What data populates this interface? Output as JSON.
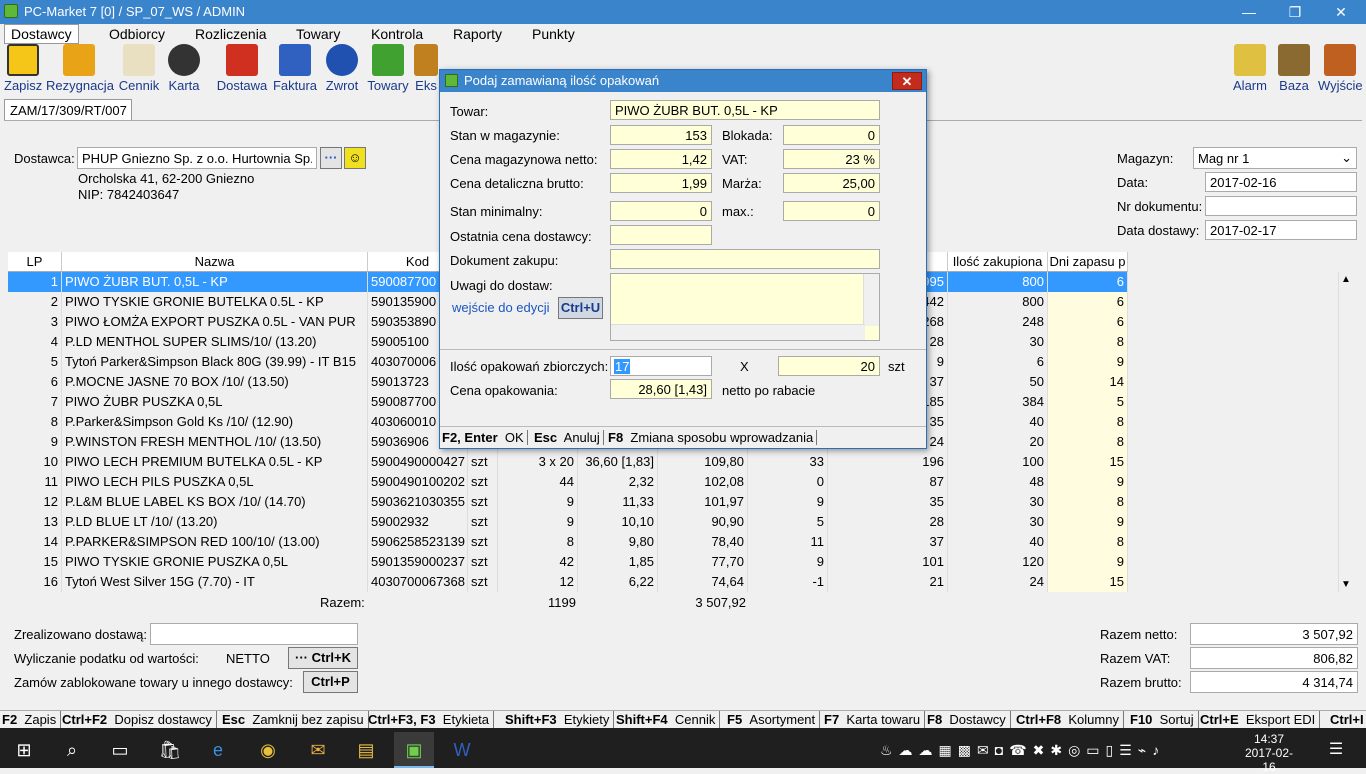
{
  "window": {
    "title": "PC-Market 7 [0] / SP_07_WS / ADMIN",
    "min": "—",
    "max": "❐",
    "close": "✕"
  },
  "menu": [
    "Dostawcy",
    "Odbiorcy",
    "Rozliczenia",
    "Towary",
    "Kontrola",
    "Raporty",
    "Punkty"
  ],
  "toolbar": {
    "left": [
      "Zapisz",
      "Rezygnacja",
      "Cennik",
      "Karta",
      "Dostawa",
      "Faktura",
      "Zwrot",
      "Towary",
      "Eks"
    ],
    "right": [
      "Alarm",
      "Baza",
      "Wyjście"
    ]
  },
  "doc_tab": "ZAM/17/309/RT/007",
  "supplier": {
    "label": "Dostawca:",
    "name": "PHUP Gniezno Sp. z o.o. Hurtownia Sp.",
    "address": "Orcholska 41, 62-200 Gniezno",
    "nip": "NIP: 7842403647",
    "dots": "···"
  },
  "right_fields": {
    "magazyn_label": "Magazyn:",
    "magazyn": "Mag nr 1",
    "data_label": "Data:",
    "data": "2017-02-16",
    "nrdok_label": "Nr dokumentu:",
    "nrdok": "",
    "datadost_label": "Data dostawy:",
    "datadost": "2017-02-17"
  },
  "grid": {
    "headers": [
      "LP",
      "Nazwa",
      "Kod",
      "",
      "",
      "",
      "",
      "",
      "",
      "a",
      "Ilość zakupiona",
      "Dni zapasu p"
    ],
    "rows": [
      [
        "1",
        "PIWO ŻUBR BUT. 0,5L - KP",
        "590087700",
        "",
        "",
        "",
        "",
        "",
        "",
        "995",
        "800",
        "6"
      ],
      [
        "2",
        "PIWO TYSKIE GRONIE BUTELKA 0.5L - KP",
        "590135900",
        "",
        "",
        "",
        "",
        "",
        "",
        "442",
        "800",
        "6"
      ],
      [
        "3",
        "PIWO ŁOMŻA EXPORT PUSZKA 0.5L - VAN PUR",
        "590353890",
        "",
        "",
        "",
        "",
        "",
        "",
        "268",
        "248",
        "6"
      ],
      [
        "4",
        "P.LD MENTHOL SUPER SLIMS/10/ (13.20)",
        "59005100",
        "",
        "",
        "",
        "",
        "",
        "",
        "28",
        "30",
        "8"
      ],
      [
        "5",
        "Tytoń Parker&Simpson Black 80G (39.99) - IT B15",
        "403070006",
        "",
        "",
        "",
        "",
        "",
        "",
        "9",
        "6",
        "9"
      ],
      [
        "6",
        "P.MOCNE JASNE 70 BOX /10/ (13.50)",
        "59013723",
        "",
        "",
        "",
        "",
        "",
        "",
        "37",
        "50",
        "14"
      ],
      [
        "7",
        "PIWO ŻUBR PUSZKA 0,5L",
        "590087700",
        "",
        "",
        "",
        "",
        "",
        "",
        "185",
        "384",
        "5"
      ],
      [
        "8",
        "P.Parker&Simpson Gold Ks /10/ (12.90)",
        "403060010",
        "",
        "",
        "",
        "",
        "",
        "",
        "35",
        "40",
        "8"
      ],
      [
        "9",
        "P.WINSTON FRESH MENTHOL /10/ (13.50)",
        "59036906",
        "",
        "",
        "",
        "",
        "",
        "",
        "24",
        "20",
        "8"
      ],
      [
        "10",
        "PIWO LECH PREMIUM BUTELKA 0.5L - KP",
        "5900490000427",
        "szt",
        "3 x 20",
        "36,60 [1,83]",
        "109,80",
        "33",
        "",
        "196",
        "100",
        "15"
      ],
      [
        "11",
        "PIWO LECH PILS PUSZKA 0,5L",
        "5900490100202",
        "szt",
        "44",
        "2,32",
        "102,08",
        "0",
        "",
        "87",
        "48",
        "9"
      ],
      [
        "12",
        "P.L&M BLUE LABEL KS BOX /10/ (14.70)",
        "5903621030355",
        "szt",
        "9",
        "11,33",
        "101,97",
        "9",
        "",
        "35",
        "30",
        "8"
      ],
      [
        "13",
        "P.LD BLUE LT /10/ (13.20)",
        "59002932",
        "szt",
        "9",
        "10,10",
        "90,90",
        "5",
        "",
        "28",
        "30",
        "9"
      ],
      [
        "14",
        "P.PARKER&SIMPSON RED 100/10/ (13.00)",
        "5906258523139",
        "szt",
        "8",
        "9,80",
        "78,40",
        "11",
        "",
        "37",
        "40",
        "8"
      ],
      [
        "15",
        "PIWO TYSKIE GRONIE PUSZKA 0,5L",
        "5901359000237",
        "szt",
        "42",
        "1,85",
        "77,70",
        "9",
        "",
        "101",
        "120",
        "9"
      ],
      [
        "16",
        "Tytoń West Silver 15G (7.70) - IT",
        "4030700067368",
        "szt",
        "12",
        "6,22",
        "74,64",
        "-1",
        "",
        "21",
        "24",
        "15"
      ]
    ],
    "razem_label": "Razem:",
    "razem_qty": "1199",
    "razem_value": "3 507,92"
  },
  "bottom": {
    "zrealizowano_label": "Zrealizowano dostawą:",
    "zrealizowano": "",
    "podatek_label": "Wyliczanie podatku od wartości:",
    "podatek": "NETTO",
    "ctrlk": "··· Ctrl+K",
    "zablok_label": "Zamów zablokowane towary u innego dostawcy:",
    "ctrlp": "Ctrl+P",
    "netto_label": "Razem netto:",
    "netto": "3 507,92",
    "vat_label": "Razem VAT:",
    "vat": "806,82",
    "brutto_label": "Razem brutto:",
    "brutto": "4 314,74"
  },
  "status_keys": [
    {
      "k": "F2",
      "t": "Zapis"
    },
    {
      "k": "Ctrl+F2",
      "t": "Dopisz dostawcy"
    },
    {
      "k": "Esc",
      "t": "Zamknij bez zapisu"
    },
    {
      "k": "Ctrl+F3, F3",
      "t": "Etykieta"
    },
    {
      "k": "Shift+F3",
      "t": "Etykiety"
    },
    {
      "k": "Shift+F4",
      "t": "Cennik"
    },
    {
      "k": "F5",
      "t": "Asortyment"
    },
    {
      "k": "F7",
      "t": "Karta towaru"
    },
    {
      "k": "F8",
      "t": "Dostawcy"
    },
    {
      "k": "Ctrl+F8",
      "t": "Kolumny"
    },
    {
      "k": "F10",
      "t": "Sortuj"
    },
    {
      "k": "Ctrl+E",
      "t": "Eksport EDI"
    },
    {
      "k": "Ctrl+I",
      "t": ""
    }
  ],
  "dialog": {
    "title": "Podaj zamawianą ilość opakowań",
    "close": "✕",
    "towar_label": "Towar:",
    "towar": "PIWO ŻUBR BUT. 0,5L - KP",
    "stan_label": "Stan w magazynie:",
    "stan": "153",
    "blokada_label": "Blokada:",
    "blokada": "0",
    "cena_netto_label": "Cena magazynowa netto:",
    "cena_netto": "1,42",
    "vat_label": "VAT:",
    "vat": "23 %",
    "cena_brutto_label": "Cena detaliczna brutto:",
    "cena_brutto": "1,99",
    "marza_label": "Marża:",
    "marza": "25,00",
    "stan_min_label": "Stan minimalny:",
    "stan_min": "0",
    "max_label": "max.:",
    "max": "0",
    "ostatnia_label": "Ostatnia cena dostawcy:",
    "ostatnia": "",
    "dokument_label": "Dokument zakupu:",
    "dokument": "",
    "uwagi_label": "Uwagi do dostaw:",
    "edycja_link": "wejście do edycji",
    "ctrlu": "Ctrl+U",
    "ilosc_label": "Ilość opakowań zbiorczych:",
    "ilosc": "17",
    "x_label": "X",
    "szt_qty": "20",
    "szt": "szt",
    "cena_op_label": "Cena opakowania:",
    "cena_op": "28,60 [1,43]",
    "po_rabacie": "netto po rabacie",
    "keys": [
      {
        "k": "F2, Enter",
        "t": "OK"
      },
      {
        "k": "Esc",
        "t": "Anuluj"
      },
      {
        "k": "F8",
        "t": "Zmiana sposobu wprowadzania"
      }
    ]
  },
  "taskbar": {
    "time": "14:37",
    "date": "2017-02-16"
  }
}
